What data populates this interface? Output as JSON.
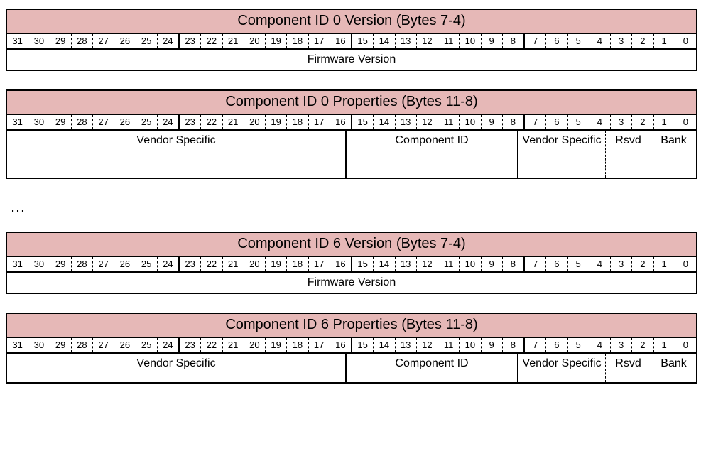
{
  "bits": [
    "31",
    "30",
    "29",
    "28",
    "27",
    "26",
    "25",
    "24",
    "23",
    "22",
    "21",
    "20",
    "19",
    "18",
    "17",
    "16",
    "15",
    "14",
    "13",
    "12",
    "11",
    "10",
    "9",
    "8",
    "7",
    "6",
    "5",
    "4",
    "3",
    "2",
    "1",
    "0"
  ],
  "ellipsis": "…",
  "reg1": {
    "title": "Component ID 0 Version (Bytes 7-4)",
    "field_full": "Firmware Version"
  },
  "reg2": {
    "title": "Component ID 0 Properties (Bytes 11-8)",
    "f_vs16": "Vendor Specific",
    "f_cid": "Component ID",
    "f_vs4": "Vendor Specific",
    "f_rsvd": "Rsvd",
    "f_bank": "Bank"
  },
  "reg3": {
    "title": "Component ID 6 Version (Bytes 7-4)",
    "field_full": "Firmware Version"
  },
  "reg4": {
    "title": "Component ID 6 Properties (Bytes 11-8)",
    "f_vs16": "Vendor Specific",
    "f_cid": "Component ID",
    "f_vs4": "Vendor Specific",
    "f_rsvd": "Rsvd",
    "f_bank": "Bank"
  }
}
